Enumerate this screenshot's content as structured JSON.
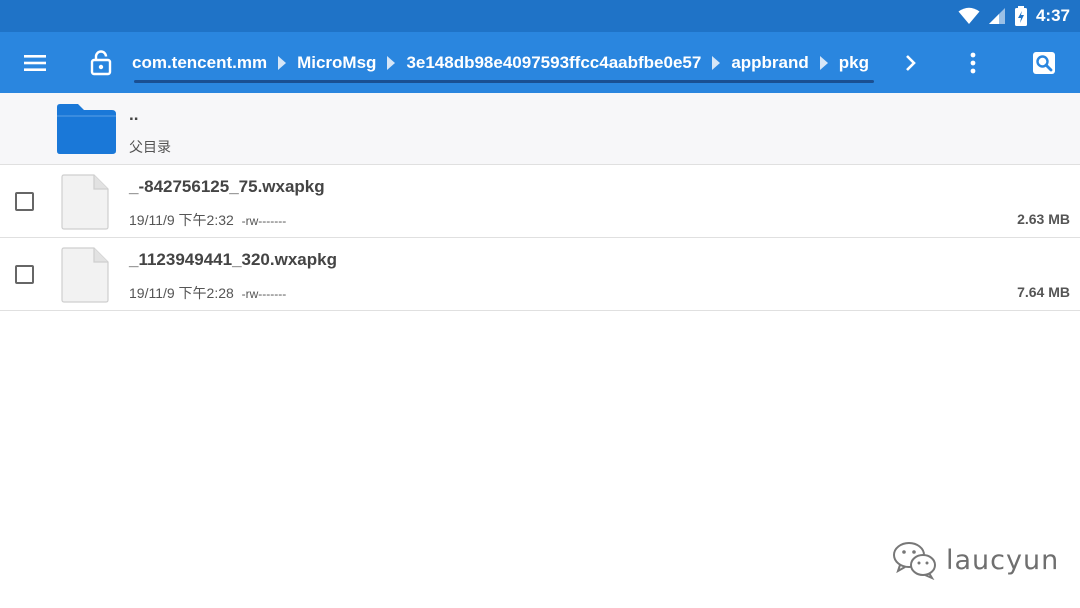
{
  "status": {
    "time": "4:37"
  },
  "toolbar": {
    "menu_icon": "hamburger-menu-icon",
    "lock_icon": "unlock-icon",
    "breadcrumbs": [
      "com.tencent.mm",
      "MicroMsg",
      "3e148db98e4097593ffcc4aabfbe0e57",
      "appbrand",
      "pkg"
    ],
    "more_icon": "more-vertical-icon",
    "search_icon": "search-icon"
  },
  "parent": {
    "name": "..",
    "label": "父目录"
  },
  "files": [
    {
      "name": "_-842756125_75.wxapkg",
      "date": "19/11/9 下午2:32",
      "perms": "-rw-------",
      "size": "2.63 MB"
    },
    {
      "name": "_1123949441_320.wxapkg",
      "date": "19/11/9 下午2:28",
      "perms": "-rw-------",
      "size": "7.64 MB"
    }
  ],
  "watermark": {
    "text": "laucyun"
  },
  "colors": {
    "statusbar": "#1f73c7",
    "toolbar": "#2a86df",
    "folder": "#1a78d8"
  }
}
